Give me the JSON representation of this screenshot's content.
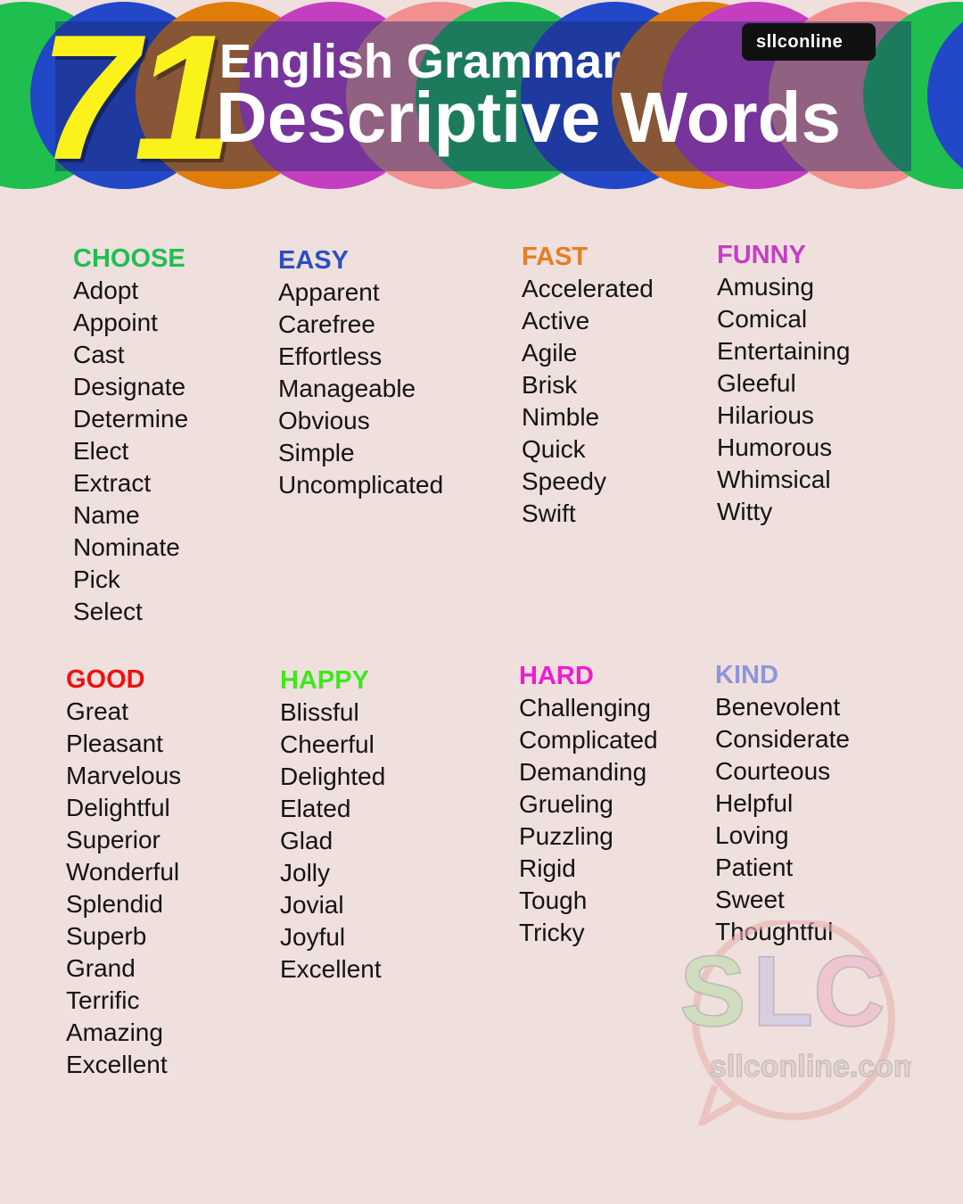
{
  "header": {
    "number": "71",
    "title_line1": "English Grammar",
    "title_line2": "Descriptive Words",
    "brand": "sllconline"
  },
  "banner_colors": [
    "#1fbf4f",
    "#2248c8",
    "#e07c0a",
    "#c43ec0",
    "#f29090",
    "#1fbf4f",
    "#2248c8",
    "#e07c0a",
    "#c43ec0",
    "#f29090",
    "#1fbf4f",
    "#2248c8",
    "#e07c0a"
  ],
  "categories": [
    {
      "title": "CHOOSE",
      "color": "#1fbf4f",
      "words": [
        "Adopt",
        "Appoint",
        "Cast",
        "Designate",
        "Determine",
        "Elect",
        "Extract",
        "Name",
        "Nominate",
        "Pick",
        "Select"
      ]
    },
    {
      "title": "EASY",
      "color": "#2b4fbf",
      "words": [
        "Apparent",
        "Carefree",
        "Effortless",
        "Manageable",
        "Obvious",
        "Simple",
        "Uncomplicated"
      ]
    },
    {
      "title": "FAST",
      "color": "#e67e22",
      "words": [
        "Accelerated",
        "Active",
        "Agile",
        "Brisk",
        "Nimble",
        "Quick",
        "Speedy",
        "Swift"
      ]
    },
    {
      "title": "FUNNY",
      "color": "#c53fc3",
      "words": [
        "Amusing",
        "Comical",
        "Entertaining",
        "Gleeful",
        "Hilarious",
        "Humorous",
        "Whimsical",
        "Witty"
      ]
    },
    {
      "title": "GOOD",
      "color": "#ee1111",
      "words": [
        "Great",
        "Pleasant",
        "Marvelous",
        "Delightful",
        "Superior",
        "Wonderful",
        "Splendid",
        "Superb",
        "Grand",
        "Terrific",
        "Amazing",
        "Excellent"
      ]
    },
    {
      "title": "HAPPY",
      "color": "#3ee81c",
      "words": [
        "Blissful",
        "Cheerful",
        "Delighted",
        "Elated",
        "Glad",
        "Jolly",
        "Jovial",
        "Joyful",
        "Excellent"
      ]
    },
    {
      "title": "HARD",
      "color": "#f01ccf",
      "words": [
        "Challenging",
        "Complicated",
        "Demanding",
        "Grueling",
        "Puzzling",
        "Rigid",
        "Tough",
        "Tricky"
      ]
    },
    {
      "title": "KIND",
      "color": "#8c96dc",
      "words": [
        "Benevolent",
        "Considerate",
        "Courteous",
        "Helpful",
        "Loving",
        "Patient",
        "Sweet",
        "Thoughtful"
      ]
    }
  ],
  "watermark": {
    "logo": "SLC",
    "site": "sllconline.com"
  }
}
